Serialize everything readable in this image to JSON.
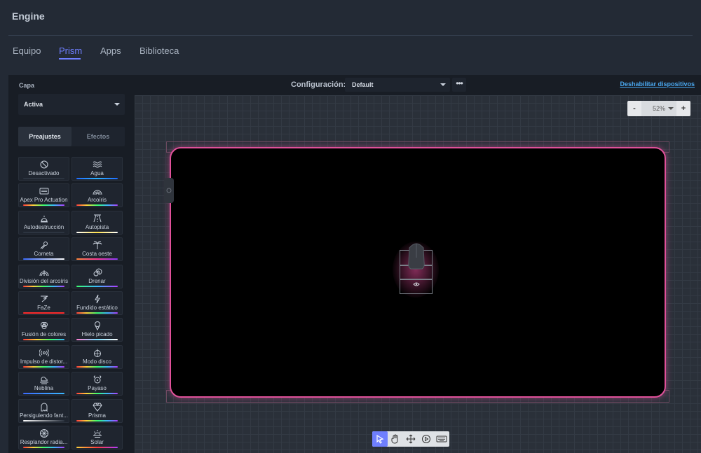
{
  "app": {
    "title": "Engine"
  },
  "tabs": [
    {
      "label": "Equipo"
    },
    {
      "label": "Prism",
      "active": true
    },
    {
      "label": "Apps"
    },
    {
      "label": "Biblioteca"
    }
  ],
  "toolbar": {
    "config_label": "Configuración:",
    "config_value": "Default",
    "more_label": "•••",
    "disable_link": "Deshabilitar dispositivos"
  },
  "sidebar": {
    "layer_label": "Capa",
    "layer_value": "Activa",
    "segments": [
      "Preajustes",
      "Efectos"
    ],
    "presets": [
      {
        "label": "Desactivado",
        "icon": "ban-icon",
        "bar": "#2c3440"
      },
      {
        "label": "Agua",
        "icon": "waves-icon",
        "bar": "linear-gradient(90deg,#1e6bff,#2fb3ff,#1e6bff)"
      },
      {
        "label": "Apex Pro Actuation",
        "icon": "keyboard-icon",
        "bar": "linear-gradient(90deg,#ff3b3b,#ffd23b,#3bff6b,#3bb8ff,#b03bff)"
      },
      {
        "label": "Arcoíris",
        "icon": "rainbow-icon",
        "bar": "linear-gradient(90deg,#ff3b3b,#ffd23b,#3bff6b,#3bb8ff,#b03bff)"
      },
      {
        "label": "Autodestrucción",
        "icon": "alarm-icon",
        "bar": "#2c3440"
      },
      {
        "label": "Autopista",
        "icon": "road-icon",
        "bar": "linear-gradient(90deg,#ffffff,#ffe14a,#ffffff)"
      },
      {
        "label": "Cometa",
        "icon": "comet-icon",
        "bar": "linear-gradient(90deg,#3b6bff,#ffffff)"
      },
      {
        "label": "Costa oeste",
        "icon": "palm-icon",
        "bar": "linear-gradient(90deg,#ff8a3b,#ff3b9a,#8a3bff)"
      },
      {
        "label": "División del arcoíris",
        "icon": "split-rainbow-icon",
        "bar": "linear-gradient(90deg,#ff3b3b,#ffd23b,#3bff6b,#3bb8ff,#b03bff)"
      },
      {
        "label": "Drenar",
        "icon": "spiral-icon",
        "bar": "linear-gradient(90deg,#3bff6b,#3bb8ff,#b03bff)"
      },
      {
        "label": "FaZe",
        "icon": "faze-icon",
        "bar": "linear-gradient(90deg,#ff2b2b,#ff2b2b)"
      },
      {
        "label": "Fundido estático",
        "icon": "bolt-icon",
        "bar": "linear-gradient(90deg,#ff3b3b,#ffd23b,#3bff6b,#3bb8ff,#b03bff)"
      },
      {
        "label": "Fusión de colores",
        "icon": "color-blend-icon",
        "bar": "linear-gradient(90deg,#ff3b3b,#ffd23b,#3bff6b,#3bb8ff)"
      },
      {
        "label": "Hielo picado",
        "icon": "ice-cream-icon",
        "bar": "linear-gradient(90deg,#ff7ad0,#7ae0ff,#ffffff)"
      },
      {
        "label": "Impulso de distor...",
        "icon": "pulse-icon",
        "bar": "linear-gradient(90deg,#ff3b3b,#ffd23b,#3bff6b,#3bb8ff,#b03bff)"
      },
      {
        "label": "Modo disco",
        "icon": "disco-ball-icon",
        "bar": "linear-gradient(90deg,#ff3b3b,#ffd23b,#3bff6b,#3bb8ff,#b03bff)"
      },
      {
        "label": "Neblina",
        "icon": "fog-icon",
        "bar": "linear-gradient(90deg,#3b6bff,#3bb8ff)"
      },
      {
        "label": "Payaso",
        "icon": "clown-icon",
        "bar": "linear-gradient(90deg,#ff3b3b,#ffd23b,#3bff6b,#3bb8ff,#b03bff)"
      },
      {
        "label": "Persiguiendo fant...",
        "icon": "ghost-icon",
        "bar": "linear-gradient(90deg,#ffffff,#2c3440)"
      },
      {
        "label": "Prisma",
        "icon": "diamond-icon",
        "bar": "linear-gradient(90deg,#ff3b3b,#ffd23b,#3bff6b,#3bb8ff,#b03bff)"
      },
      {
        "label": "Resplandor radia...",
        "icon": "radial-icon",
        "bar": "linear-gradient(90deg,#ff3b3b,#ffd23b,#3bff6b,#3bb8ff,#b03bff)"
      },
      {
        "label": "Solar",
        "icon": "sunrise-icon",
        "bar": "linear-gradient(90deg,#ffd23b,#ff3b3b,#b03bff)"
      }
    ]
  },
  "zoom": {
    "minus": "-",
    "value": "52%",
    "plus": "+"
  },
  "colors": {
    "accent": "#6f7fff",
    "mat_glow": "#e0519a",
    "link": "#4aa8f0"
  },
  "tools": [
    "select-tool-icon",
    "hand-tool-icon",
    "move-tool-icon",
    "play-tool-icon",
    "keyboard-tool-icon"
  ]
}
